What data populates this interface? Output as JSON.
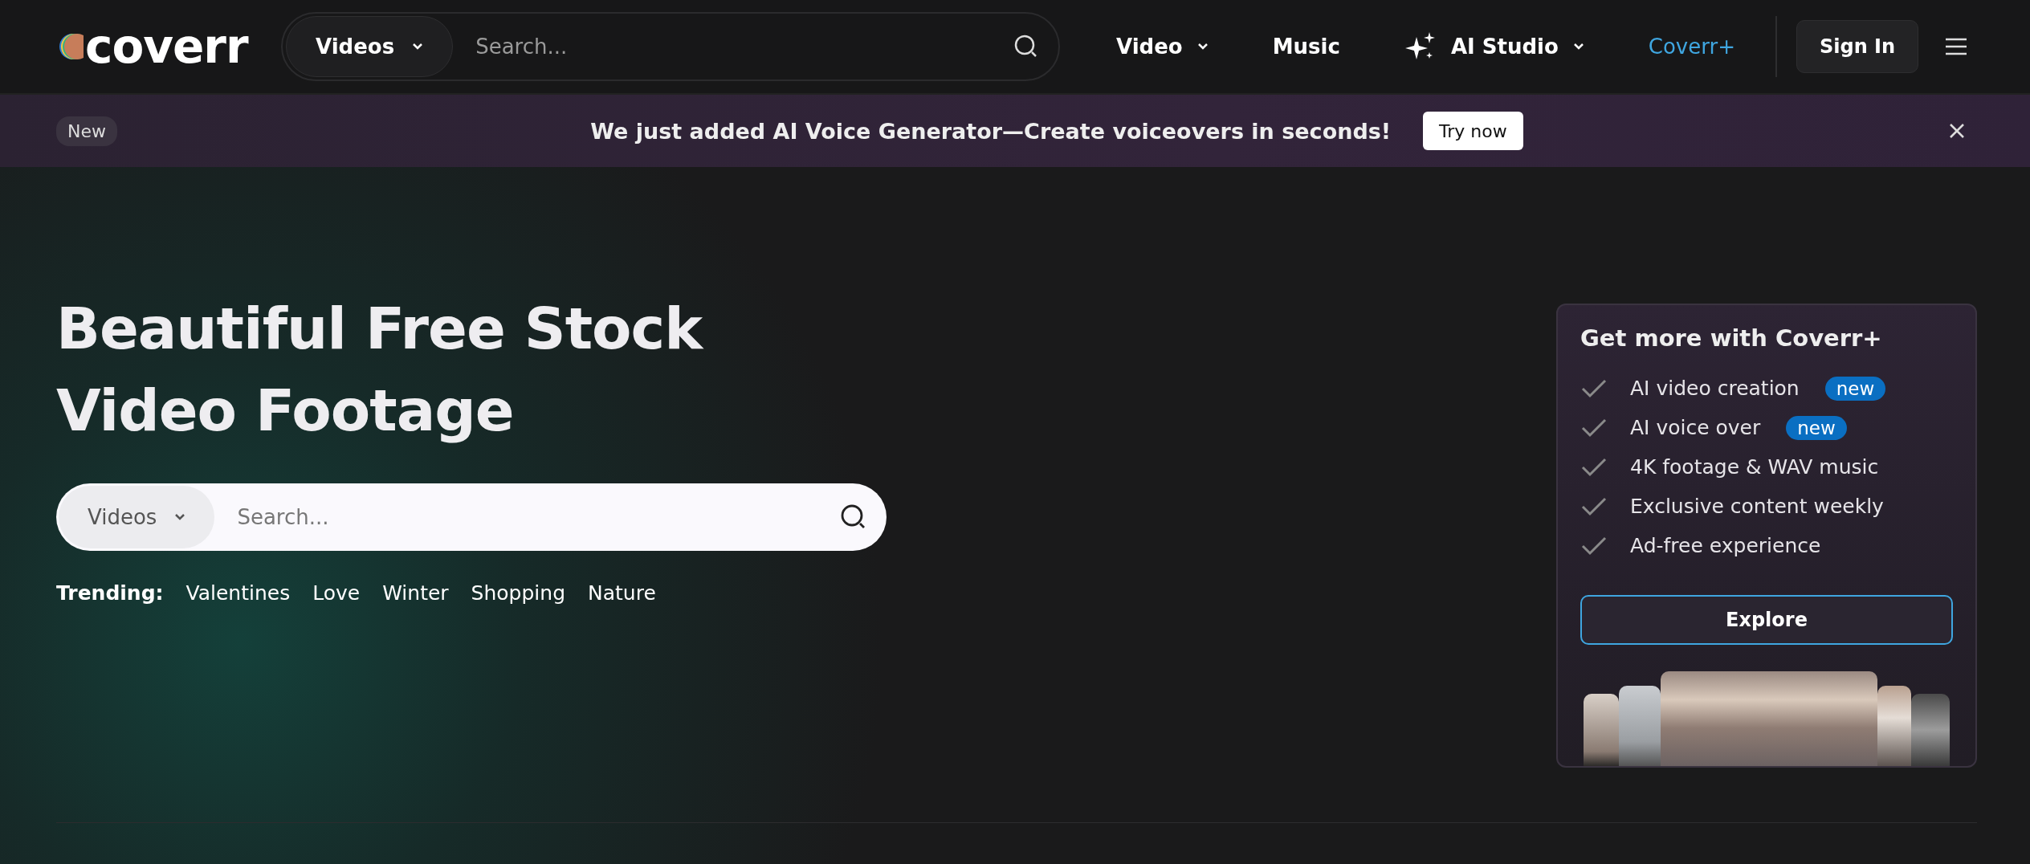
{
  "header": {
    "logo": "coverr",
    "search": {
      "category": "Videos",
      "placeholder": "Search..."
    },
    "nav": [
      {
        "label": "Video",
        "kind": "dropdown"
      },
      {
        "label": "Music",
        "kind": "link"
      },
      {
        "label": "AI Studio",
        "kind": "ai"
      },
      {
        "label": "Coverr+",
        "kind": "accent"
      }
    ],
    "sign_in": "Sign In"
  },
  "banner": {
    "badge": "New",
    "message": "We just added AI Voice Generator—Create voiceovers in seconds!",
    "action": "Try now"
  },
  "hero": {
    "title_lines": [
      "Beautiful Free Stock",
      "Video Footage"
    ],
    "search": {
      "category": "Videos",
      "placeholder": "Search..."
    },
    "trending_label": "Trending:",
    "trending": [
      "Valentines",
      "Love",
      "Winter",
      "Shopping",
      "Nature"
    ]
  },
  "promo": {
    "title": "Get more with Coverr+",
    "features": [
      {
        "label": "AI video creation",
        "badge": "new"
      },
      {
        "label": "AI voice over",
        "badge": "new"
      },
      {
        "label": "4K footage & WAV music"
      },
      {
        "label": "Exclusive content weekly"
      },
      {
        "label": "Ad-free experience"
      }
    ],
    "button": "Explore"
  }
}
